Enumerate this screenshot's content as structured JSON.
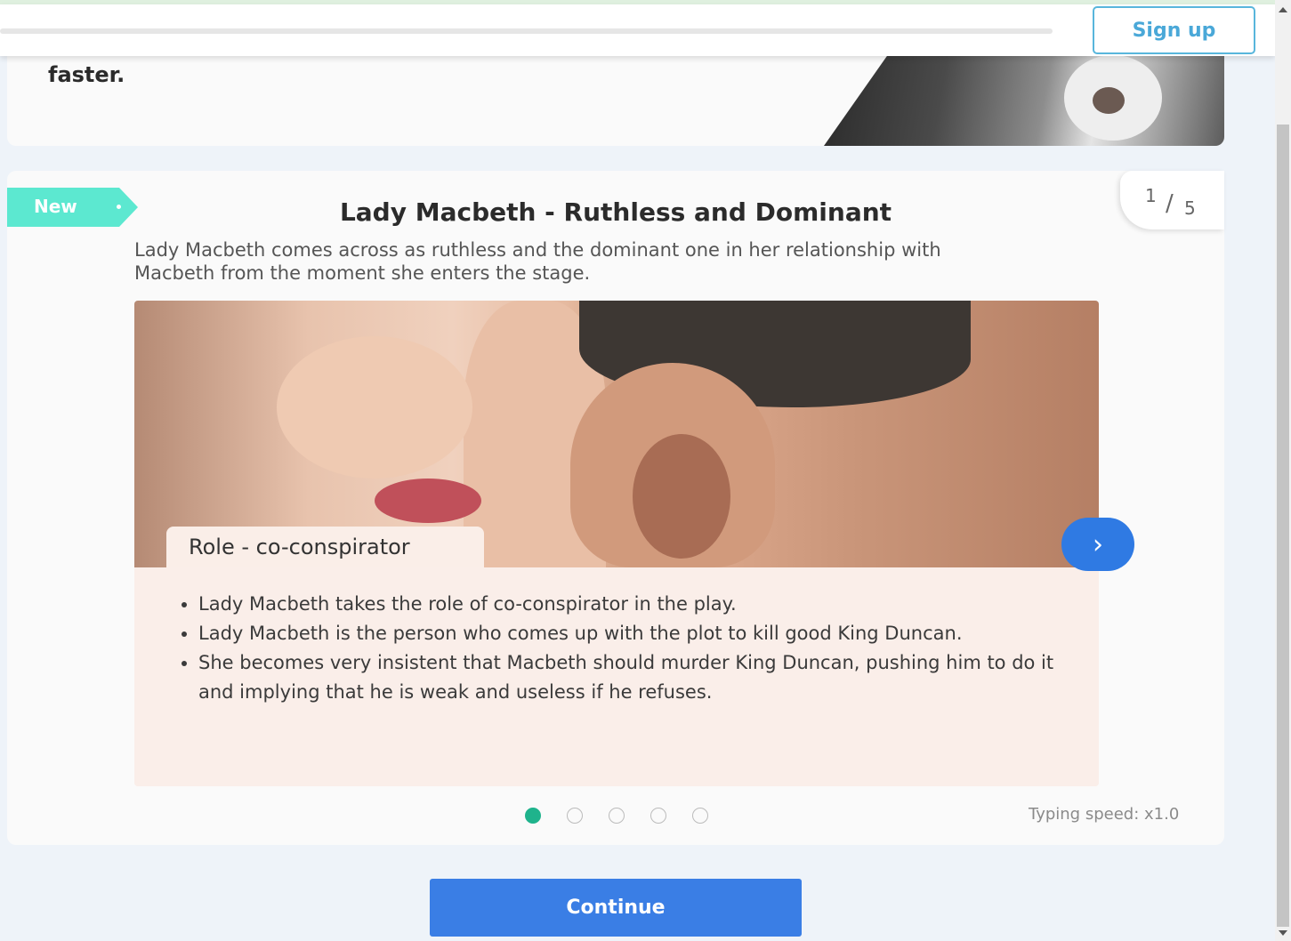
{
  "header": {
    "signup_label": "Sign up"
  },
  "previous_card": {
    "text_tail": "faster."
  },
  "card": {
    "badge": "New",
    "counter_current": "1",
    "counter_separator": "/",
    "counter_total": "5",
    "title": "Lady Macbeth - Ruthless and Dominant",
    "subtitle": "Lady Macbeth comes across as ruthless and the dominant one in her relationship with Macbeth from the moment she enters the stage.",
    "slide": {
      "role_label": "Role - co-conspirator",
      "bullets": [
        "Lady Macbeth takes the role of co-conspirator in the play.",
        "Lady Macbeth is the person who comes up with the plot to kill good King Duncan.",
        "She becomes very insistent that Macbeth should murder King Duncan, pushing him to do it and implying that he is weak and useless if he refuses."
      ],
      "next_icon": "chevron-right-icon",
      "active_slide": 1,
      "total_slides": 5
    },
    "typing_speed": "Typing speed: x1.0"
  },
  "footer": {
    "continue_label": "Continue"
  },
  "colors": {
    "accent_blue": "#3a7ee5",
    "badge_teal": "#5ce8d0",
    "dot_active": "#1fb38c",
    "signup_border": "#58b6dc"
  }
}
